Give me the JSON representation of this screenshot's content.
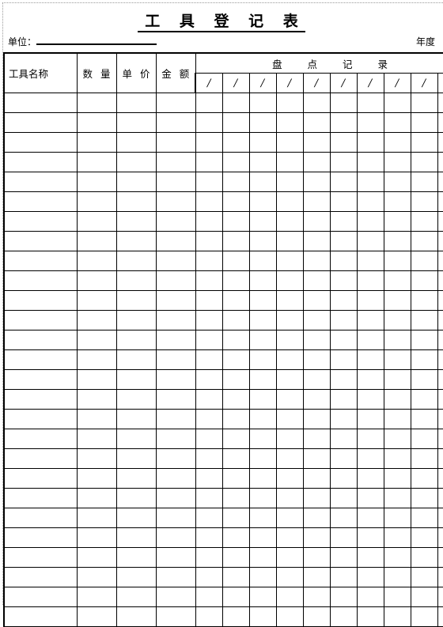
{
  "document": {
    "title": "工 具 登 记 表"
  },
  "meta": {
    "unit_label": "单位：",
    "unit_value": "",
    "year_label": "年度",
    "year_value": ""
  },
  "table": {
    "headers": {
      "tool_name": "工具名称",
      "quantity": "数 量",
      "unit_price": "单 价",
      "amount": "金 额",
      "inventory_group": "盘 点 记 录"
    },
    "inventory_subheaders": [
      "/",
      "/",
      "/",
      "/",
      "/",
      "/",
      "/",
      "/",
      "/",
      "/"
    ],
    "inventory_column_count": 10,
    "body_row_count": 27,
    "body_rows": [
      [
        "",
        "",
        "",
        "",
        "",
        "",
        "",
        "",
        "",
        "",
        "",
        "",
        "",
        ""
      ],
      [
        "",
        "",
        "",
        "",
        "",
        "",
        "",
        "",
        "",
        "",
        "",
        "",
        "",
        ""
      ],
      [
        "",
        "",
        "",
        "",
        "",
        "",
        "",
        "",
        "",
        "",
        "",
        "",
        "",
        ""
      ],
      [
        "",
        "",
        "",
        "",
        "",
        "",
        "",
        "",
        "",
        "",
        "",
        "",
        "",
        ""
      ],
      [
        "",
        "",
        "",
        "",
        "",
        "",
        "",
        "",
        "",
        "",
        "",
        "",
        "",
        ""
      ],
      [
        "",
        "",
        "",
        "",
        "",
        "",
        "",
        "",
        "",
        "",
        "",
        "",
        "",
        ""
      ],
      [
        "",
        "",
        "",
        "",
        "",
        "",
        "",
        "",
        "",
        "",
        "",
        "",
        "",
        ""
      ],
      [
        "",
        "",
        "",
        "",
        "",
        "",
        "",
        "",
        "",
        "",
        "",
        "",
        "",
        ""
      ],
      [
        "",
        "",
        "",
        "",
        "",
        "",
        "",
        "",
        "",
        "",
        "",
        "",
        "",
        ""
      ],
      [
        "",
        "",
        "",
        "",
        "",
        "",
        "",
        "",
        "",
        "",
        "",
        "",
        "",
        ""
      ],
      [
        "",
        "",
        "",
        "",
        "",
        "",
        "",
        "",
        "",
        "",
        "",
        "",
        "",
        ""
      ],
      [
        "",
        "",
        "",
        "",
        "",
        "",
        "",
        "",
        "",
        "",
        "",
        "",
        "",
        ""
      ],
      [
        "",
        "",
        "",
        "",
        "",
        "",
        "",
        "",
        "",
        "",
        "",
        "",
        "",
        ""
      ],
      [
        "",
        "",
        "",
        "",
        "",
        "",
        "",
        "",
        "",
        "",
        "",
        "",
        "",
        ""
      ],
      [
        "",
        "",
        "",
        "",
        "",
        "",
        "",
        "",
        "",
        "",
        "",
        "",
        "",
        ""
      ],
      [
        "",
        "",
        "",
        "",
        "",
        "",
        "",
        "",
        "",
        "",
        "",
        "",
        "",
        ""
      ],
      [
        "",
        "",
        "",
        "",
        "",
        "",
        "",
        "",
        "",
        "",
        "",
        "",
        "",
        ""
      ],
      [
        "",
        "",
        "",
        "",
        "",
        "",
        "",
        "",
        "",
        "",
        "",
        "",
        "",
        ""
      ],
      [
        "",
        "",
        "",
        "",
        "",
        "",
        "",
        "",
        "",
        "",
        "",
        "",
        "",
        ""
      ],
      [
        "",
        "",
        "",
        "",
        "",
        "",
        "",
        "",
        "",
        "",
        "",
        "",
        "",
        ""
      ],
      [
        "",
        "",
        "",
        "",
        "",
        "",
        "",
        "",
        "",
        "",
        "",
        "",
        "",
        ""
      ],
      [
        "",
        "",
        "",
        "",
        "",
        "",
        "",
        "",
        "",
        "",
        "",
        "",
        "",
        ""
      ],
      [
        "",
        "",
        "",
        "",
        "",
        "",
        "",
        "",
        "",
        "",
        "",
        "",
        "",
        ""
      ],
      [
        "",
        "",
        "",
        "",
        "",
        "",
        "",
        "",
        "",
        "",
        "",
        "",
        "",
        ""
      ],
      [
        "",
        "",
        "",
        "",
        "",
        "",
        "",
        "",
        "",
        "",
        "",
        "",
        "",
        ""
      ],
      [
        "",
        "",
        "",
        "",
        "",
        "",
        "",
        "",
        "",
        "",
        "",
        "",
        "",
        ""
      ],
      [
        "",
        "",
        "",
        "",
        "",
        "",
        "",
        "",
        "",
        "",
        "",
        "",
        "",
        ""
      ]
    ]
  },
  "style": {
    "ink": "#000000",
    "paper": "#ffffff",
    "margin_guide": "#9a9a9a"
  }
}
